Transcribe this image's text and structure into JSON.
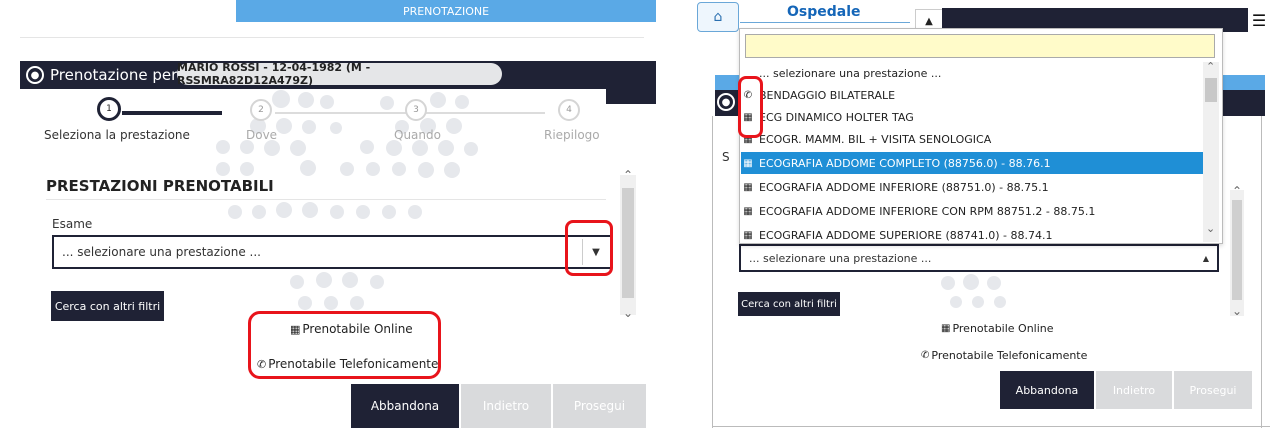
{
  "left": {
    "header_title": "PRENOTAZIONE",
    "booking_for_label": "Prenotazione per",
    "patient": "MARIO ROSSI - 12-04-1982 (M - RSSMRA82D12A479Z)",
    "steps": [
      {
        "num": "1",
        "label": "Seleziona la prestazione"
      },
      {
        "num": "2",
        "label": "Dove"
      },
      {
        "num": "3",
        "label": "Quando"
      },
      {
        "num": "4",
        "label": "Riepilogo"
      }
    ],
    "section_title": "PRESTAZIONI PRENOTABILI",
    "field_label": "Esame",
    "select_placeholder": "... selezionare una prestazione ...",
    "other_filters_btn": "Cerca con altri filtri",
    "legend_online": "Prenotabile Online",
    "legend_phone": "Prenotabile Telefonicamente",
    "btn_abandon": "Abbandona",
    "btn_back": "Indietro",
    "btn_next": "Prosegui"
  },
  "right": {
    "brand": "Ospedale",
    "search_value": "",
    "options": [
      {
        "icon": "none",
        "label": "... selezionare una prestazione ..."
      },
      {
        "icon": "phone",
        "label": "BENDAGGIO BILATERALE"
      },
      {
        "icon": "calendar",
        "label": "ECG DINAMICO HOLTER TAG"
      },
      {
        "icon": "calendar",
        "label": "ECOGR. MAMM. BIL + VISITA SENOLOGICA"
      },
      {
        "icon": "calendar",
        "label": "ECOGRAFIA ADDOME COMPLETO (88756.0) - 88.76.1",
        "selected": true
      },
      {
        "icon": "calendar",
        "label": "ECOGRAFIA ADDOME INFERIORE (88751.0) - 88.75.1"
      },
      {
        "icon": "calendar",
        "label": "ECOGRAFIA ADDOME INFERIORE CON RPM 88751.2 - 88.75.1"
      },
      {
        "icon": "calendar",
        "label": "ECOGRAFIA ADDOME SUPERIORE (88741.0) - 88.74.1"
      }
    ],
    "select_placeholder": "... selezionare una prestazione ...",
    "other_filters_btn": "Cerca con altri filtri",
    "legend_online": "Prenotabile Online",
    "legend_phone": "Prenotabile Telefonicamente",
    "btn_abandon": "Abbandona",
    "btn_back": "Indietro",
    "btn_next": "Prosegui"
  },
  "colors": {
    "navy": "#1f2235",
    "accent_blue": "#1f8fd6",
    "header_blue": "#5aa9e6",
    "highlight_red": "#e8141b",
    "search_bg": "#fffbc9"
  }
}
